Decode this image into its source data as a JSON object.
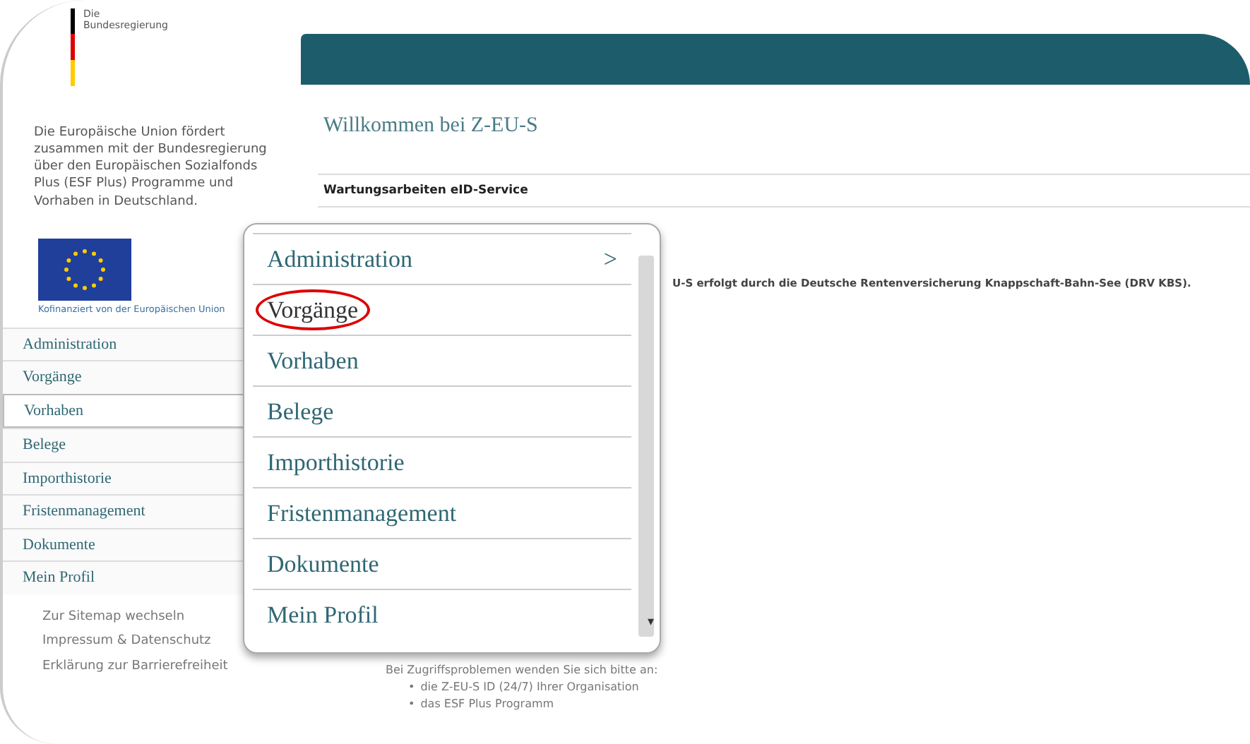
{
  "sidebar": {
    "logo_text": "Die Bundesregierung",
    "intro": "Die Europäische Union fördert zusammen mit der Bundesregierung über den Europäischen Sozialfonds Plus (ESF Plus) Programme und Vorhaben in Deutschland.",
    "eu_caption": "Kofinanziert von der Europäischen Union",
    "nav": [
      {
        "label": "Administration",
        "selected": false
      },
      {
        "label": "Vorgänge",
        "selected": false
      },
      {
        "label": "Vorhaben",
        "selected": true
      },
      {
        "label": "Belege",
        "selected": false
      },
      {
        "label": "Importhistorie",
        "selected": false
      },
      {
        "label": "Fristenmanagement",
        "selected": false
      },
      {
        "label": "Dokumente",
        "selected": false
      },
      {
        "label": "Mein Profil",
        "selected": false
      }
    ],
    "footer_links": [
      "Zur Sitemap wechseln",
      "Impressum & Datenschutz",
      "Erklärung zur Barrierefreiheit"
    ]
  },
  "main": {
    "title": "Willkommen bei Z-EU-S",
    "notice_title": "Wartungsarbeiten eID-Service",
    "notice_text": "U-S erfolgt durch die Deutsche Rentenversicherung Knappschaft-Bahn-See (DRV KBS).",
    "contact_intro": "Bei Zugriffsproblemen wenden Sie sich bitte an:",
    "contacts": [
      {
        "bullet": "•",
        "text": "die Z-EU-S ID (24/7) Ihrer Organisation"
      },
      {
        "bullet": "•",
        "text": "das ESF Plus Programm"
      }
    ]
  },
  "popup_menu": {
    "items": [
      {
        "label": "Administration",
        "submenu": true,
        "circled": false
      },
      {
        "label": "Vorgänge",
        "submenu": false,
        "circled": true
      },
      {
        "label": "Vorhaben",
        "submenu": false,
        "circled": false
      },
      {
        "label": "Belege",
        "submenu": false,
        "circled": false
      },
      {
        "label": "Importhistorie",
        "submenu": false,
        "circled": false
      },
      {
        "label": "Fristenmanagement",
        "submenu": false,
        "circled": false
      },
      {
        "label": "Dokumente",
        "submenu": false,
        "circled": false
      },
      {
        "label": "Mein Profil",
        "submenu": false,
        "circled": false
      }
    ],
    "submenu_glyph": ">",
    "scroll_down_glyph": "▾"
  }
}
